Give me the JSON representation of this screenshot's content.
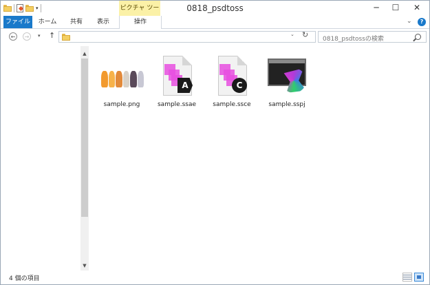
{
  "window": {
    "title": "0818_psdtoss"
  },
  "ribbon": {
    "contextual_group": "ピクチャ ツール",
    "tabs": [
      "ファイル",
      "ホーム",
      "共有",
      "表示",
      "操作"
    ]
  },
  "titlebar": {
    "minimize": "─",
    "maximize": "☐",
    "close": "✕"
  },
  "nav": {
    "back": "←",
    "forward": "→",
    "recent": "▾",
    "up": "↑",
    "address_dropdown": "⌄",
    "refresh": "↻",
    "search_placeholder": "0818_psdtossの検索"
  },
  "files": [
    {
      "name": "sample.png"
    },
    {
      "name": "sample.ssae",
      "badge": "A"
    },
    {
      "name": "sample.ssce",
      "badge": "C"
    },
    {
      "name": "sample.sspj"
    }
  ],
  "status": {
    "item_count": "4 個の項目"
  },
  "help": "?",
  "ribbon_chevron": "⌄",
  "scroll": {
    "up": "▲",
    "down": "▼"
  }
}
